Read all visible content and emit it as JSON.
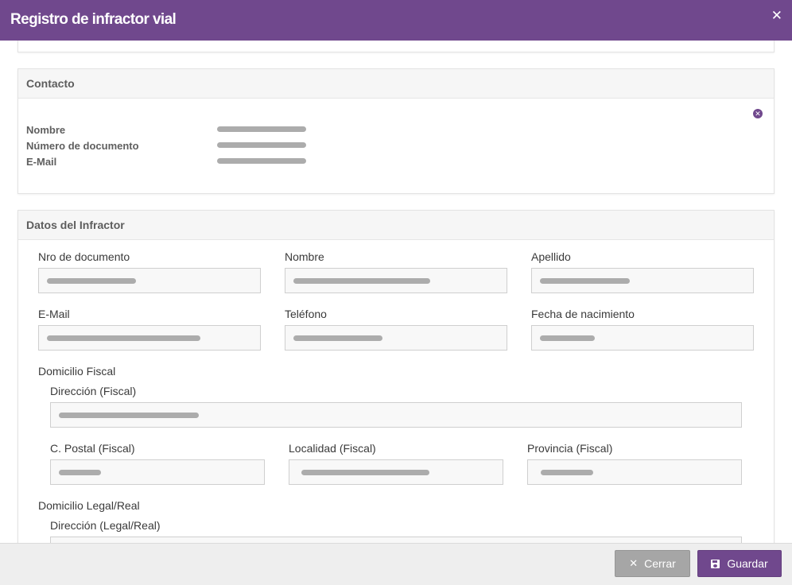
{
  "modal": {
    "title": "Registro de infractor vial",
    "close_symbol": "✕"
  },
  "contacto": {
    "heading": "Contacto",
    "rows": [
      {
        "label": "Nombre",
        "value_bar_fraction": 0.5
      },
      {
        "label": "Número de documento",
        "value_bar_fraction": 0.5
      },
      {
        "label": "E-Mail",
        "value_bar_fraction": 0.5
      }
    ],
    "remove_icon": "x-circle-icon"
  },
  "datos_infractor": {
    "heading": "Datos del Infractor",
    "fields": {
      "nro_documento": {
        "label": "Nro de documento"
      },
      "nombre": {
        "label": "Nombre"
      },
      "apellido": {
        "label": "Apellido"
      },
      "email": {
        "label": "E-Mail"
      },
      "telefono": {
        "label": "Teléfono"
      },
      "fecha_nacimiento": {
        "label": "Fecha de nacimiento"
      }
    },
    "domicilio_fiscal": {
      "heading": "Domicilio Fiscal",
      "direccion": {
        "label": "Dirección (Fiscal)"
      },
      "cpostal": {
        "label": "C. Postal (Fiscal)"
      },
      "localidad": {
        "label": "Localidad (Fiscal)"
      },
      "provincia": {
        "label": "Provincia (Fiscal)"
      }
    },
    "domicilio_legal": {
      "heading": "Domicilio Legal/Real",
      "direccion": {
        "label": "Dirección (Legal/Real)"
      }
    }
  },
  "footer": {
    "cerrar_label": "Cerrar",
    "guardar_label": "Guardar",
    "cerrar_icon": "close-icon",
    "guardar_icon": "save-icon"
  },
  "colors": {
    "accent": "#70488d",
    "placeholder_bar": "#acacac",
    "cerrar_button": "#a6a6a6"
  }
}
